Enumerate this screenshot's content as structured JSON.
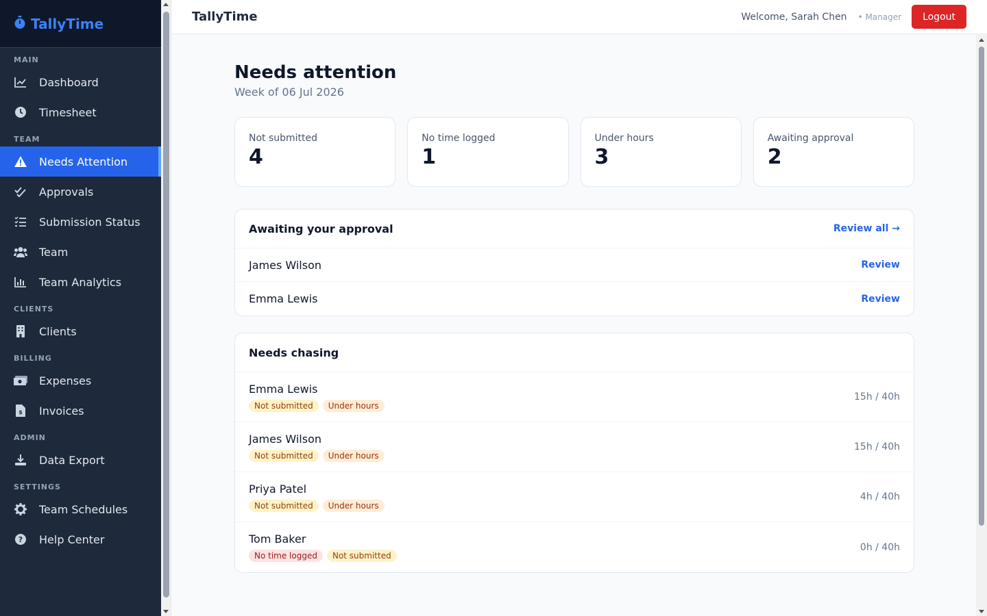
{
  "app": {
    "brand": "TallyTime",
    "title": "TallyTime"
  },
  "user": {
    "welcome": "Welcome, Sarah Chen",
    "role": "• Manager",
    "logout_label": "Logout"
  },
  "sidebar": {
    "sections": [
      {
        "label": "MAIN",
        "items": [
          {
            "label": "Dashboard",
            "icon": "chart-line-icon"
          },
          {
            "label": "Timesheet",
            "icon": "clock-icon"
          }
        ]
      },
      {
        "label": "TEAM",
        "items": [
          {
            "label": "Needs Attention",
            "icon": "warning-icon",
            "active": true
          },
          {
            "label": "Approvals",
            "icon": "check-double-icon"
          },
          {
            "label": "Submission Status",
            "icon": "list-check-icon"
          },
          {
            "label": "Team",
            "icon": "users-icon"
          },
          {
            "label": "Team Analytics",
            "icon": "bar-chart-icon"
          }
        ]
      },
      {
        "label": "CLIENTS",
        "items": [
          {
            "label": "Clients",
            "icon": "building-icon"
          }
        ]
      },
      {
        "label": "BILLING",
        "items": [
          {
            "label": "Expenses",
            "icon": "money-icon"
          },
          {
            "label": "Invoices",
            "icon": "invoice-icon"
          }
        ]
      },
      {
        "label": "ADMIN",
        "items": [
          {
            "label": "Data Export",
            "icon": "download-icon"
          }
        ]
      },
      {
        "label": "SETTINGS",
        "items": [
          {
            "label": "Team Schedules",
            "icon": "gear-icon"
          },
          {
            "label": "Help Center",
            "icon": "help-icon"
          }
        ]
      }
    ]
  },
  "page": {
    "title": "Needs attention",
    "subtitle": "Week of 06 Jul 2026"
  },
  "stats": [
    {
      "label": "Not submitted",
      "value": "4"
    },
    {
      "label": "No time logged",
      "value": "1"
    },
    {
      "label": "Under hours",
      "value": "3"
    },
    {
      "label": "Awaiting approval",
      "value": "2"
    }
  ],
  "approval": {
    "title": "Awaiting your approval",
    "review_all": "Review all →",
    "rows": [
      {
        "name": "James Wilson",
        "action": "Review"
      },
      {
        "name": "Emma Lewis",
        "action": "Review"
      }
    ]
  },
  "chasing": {
    "title": "Needs chasing",
    "rows": [
      {
        "name": "Emma Lewis",
        "tags": [
          {
            "text": "Not submitted",
            "kind": "warn"
          },
          {
            "text": "Under hours",
            "kind": "orange"
          }
        ],
        "hours": "15h / 40h"
      },
      {
        "name": "James Wilson",
        "tags": [
          {
            "text": "Not submitted",
            "kind": "warn"
          },
          {
            "text": "Under hours",
            "kind": "orange"
          }
        ],
        "hours": "15h / 40h"
      },
      {
        "name": "Priya Patel",
        "tags": [
          {
            "text": "Not submitted",
            "kind": "warn"
          },
          {
            "text": "Under hours",
            "kind": "orange"
          }
        ],
        "hours": "4h / 40h"
      },
      {
        "name": "Tom Baker",
        "tags": [
          {
            "text": "No time logged",
            "kind": "red"
          },
          {
            "text": "Not submitted",
            "kind": "warn"
          }
        ],
        "hours": "0h / 40h"
      }
    ]
  },
  "colors": {
    "accent": "#2563eb",
    "sidebar_bg": "#1e293b",
    "danger": "#dc2626"
  }
}
